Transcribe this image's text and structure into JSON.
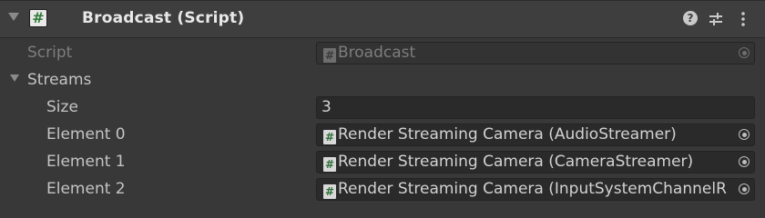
{
  "component": {
    "title": "Broadcast (Script)",
    "icon": "csharp-script-icon",
    "header_icons": [
      "help-icon",
      "preset-icon",
      "kebab-menu-icon"
    ]
  },
  "script_row": {
    "label": "Script",
    "value": "Broadcast"
  },
  "streams": {
    "label": "Streams",
    "size_label": "Size",
    "size_value": "3",
    "elements": [
      {
        "label": "Element 0",
        "value": "Render Streaming Camera (AudioStreamer)"
      },
      {
        "label": "Element 1",
        "value": "Render Streaming Camera (CameraStreamer)"
      },
      {
        "label": "Element 2",
        "value": "Render Streaming Camera (InputSystemChannelR"
      }
    ]
  },
  "colors": {
    "background": "#383838",
    "header": "#3e3e3e",
    "field": "#2a2a2a",
    "text": "#c4c4c4",
    "disabled_text": "#7d7d7d",
    "script_icon_green": "#2f7a3a"
  }
}
